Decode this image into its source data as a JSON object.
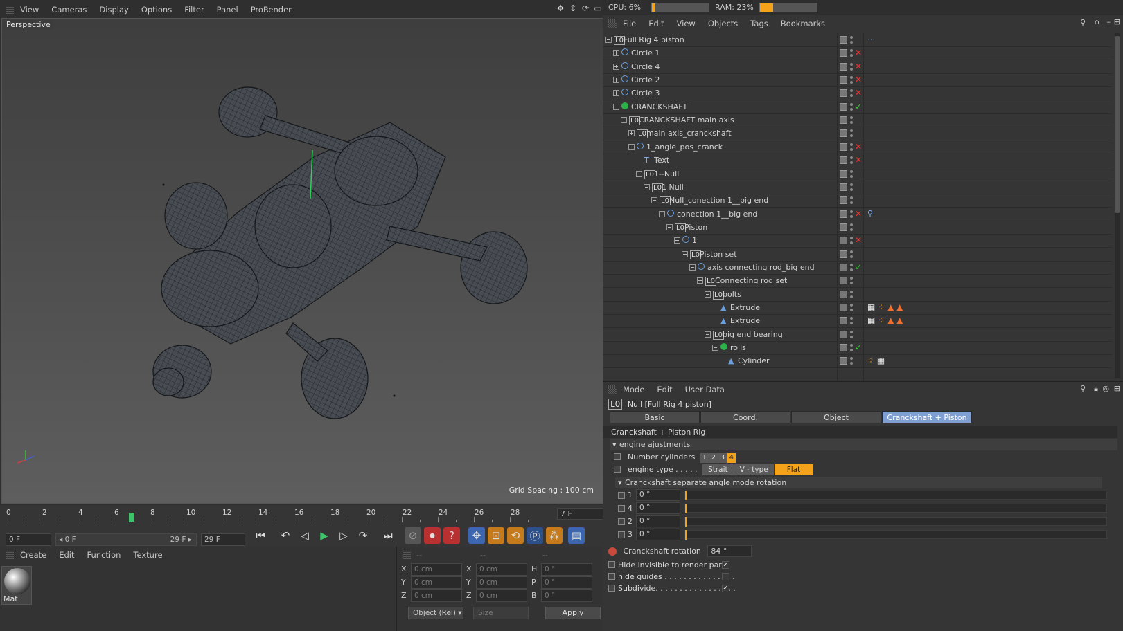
{
  "viewport": {
    "menu": [
      "View",
      "Cameras",
      "Display",
      "Options",
      "Filter",
      "Panel",
      "ProRender"
    ],
    "camera_label": "Perspective",
    "grid_spacing": "Grid Spacing : 100 cm"
  },
  "timeline": {
    "ticks": [
      "0",
      "2",
      "4",
      "6",
      "8",
      "10",
      "12",
      "14",
      "16",
      "18",
      "20",
      "22",
      "24",
      "26",
      "28"
    ],
    "current_frame": "7 F",
    "start_field": "0 F",
    "range_start": "◂ 0 F",
    "range_end": "29 F ▸",
    "end_field": "29 F"
  },
  "material_panel": {
    "menu": [
      "Create",
      "Edit",
      "Function",
      "Texture"
    ],
    "material_name": "Mat"
  },
  "coordinates": {
    "header": [
      "--",
      "--",
      "--"
    ],
    "rows": [
      {
        "a": "X",
        "av": "0 cm",
        "b": "X",
        "bv": "0 cm",
        "c": "H",
        "cv": "0 °"
      },
      {
        "a": "Y",
        "av": "0 cm",
        "b": "Y",
        "bv": "0 cm",
        "c": "P",
        "cv": "0 °"
      },
      {
        "a": "Z",
        "av": "0 cm",
        "b": "Z",
        "bv": "0 cm",
        "c": "B",
        "cv": "0 °"
      }
    ],
    "mode": "Object (Rel)",
    "size": "Size",
    "apply": "Apply"
  },
  "stats": {
    "cpu": "CPU: 6%",
    "cpu_pct": 6,
    "ram": "RAM: 23%",
    "ram_pct": 23
  },
  "object_manager": {
    "menu": [
      "File",
      "Edit",
      "View",
      "Objects",
      "Tags",
      "Bookmarks"
    ],
    "tree": [
      {
        "name": "Full Rig 4 piston",
        "depth": 0,
        "icon": "null",
        "flag": "",
        "exp": "minus"
      },
      {
        "name": "Circle 1",
        "depth": 1,
        "icon": "circle",
        "flag": "x",
        "exp": "plus"
      },
      {
        "name": "Circle 4",
        "depth": 1,
        "icon": "circle",
        "flag": "x",
        "exp": "plus"
      },
      {
        "name": "Circle 2",
        "depth": 1,
        "icon": "circle",
        "flag": "x",
        "exp": "plus"
      },
      {
        "name": "Circle 3",
        "depth": 1,
        "icon": "circle",
        "flag": "x",
        "exp": "plus"
      },
      {
        "name": "CRANCKSHAFT",
        "depth": 1,
        "icon": "gen",
        "flag": "check",
        "exp": "minus"
      },
      {
        "name": "CRANCKSHAFT main axis",
        "depth": 2,
        "icon": "null",
        "flag": "",
        "exp": "minus"
      },
      {
        "name": "main axis_cranckshaft",
        "depth": 3,
        "icon": "null",
        "flag": "",
        "exp": "plus"
      },
      {
        "name": "1_angle_pos_cranck",
        "depth": 3,
        "icon": "circle",
        "flag": "x",
        "exp": "minus"
      },
      {
        "name": "Text",
        "depth": 4,
        "icon": "text",
        "flag": "x",
        "exp": ""
      },
      {
        "name": "1--Null",
        "depth": 4,
        "icon": "null",
        "flag": "",
        "exp": "minus"
      },
      {
        "name": "1 Null",
        "depth": 5,
        "icon": "null",
        "flag": "",
        "exp": "minus"
      },
      {
        "name": "Null_conection 1__big end",
        "depth": 6,
        "icon": "null",
        "flag": "",
        "exp": "minus"
      },
      {
        "name": "conection 1__big end",
        "depth": 7,
        "icon": "circle",
        "flag": "x",
        "exp": "minus"
      },
      {
        "name": "Piston",
        "depth": 8,
        "icon": "null",
        "flag": "",
        "exp": "minus"
      },
      {
        "name": "1",
        "depth": 9,
        "icon": "circle",
        "flag": "x",
        "exp": "minus"
      },
      {
        "name": "Piston set",
        "depth": 10,
        "icon": "null",
        "flag": "",
        "exp": "minus"
      },
      {
        "name": "axis connecting rod_big end",
        "depth": 11,
        "icon": "circle",
        "flag": "check",
        "exp": "minus"
      },
      {
        "name": "Connecting rod set",
        "depth": 12,
        "icon": "null",
        "flag": "",
        "exp": "minus"
      },
      {
        "name": "bolts",
        "depth": 13,
        "icon": "null",
        "flag": "",
        "exp": "minus"
      },
      {
        "name": "Extrude",
        "depth": 14,
        "icon": "extrude",
        "flag": "",
        "exp": ""
      },
      {
        "name": "Extrude",
        "depth": 14,
        "icon": "extrude",
        "flag": "",
        "exp": ""
      },
      {
        "name": "big end bearing",
        "depth": 13,
        "icon": "null",
        "flag": "",
        "exp": "minus"
      },
      {
        "name": "rolls",
        "depth": 14,
        "icon": "gen",
        "flag": "check",
        "exp": "minus"
      },
      {
        "name": "Cylinder",
        "depth": 15,
        "icon": "extrude",
        "flag": "",
        "exp": ""
      }
    ]
  },
  "attributes": {
    "menu": [
      "Mode",
      "Edit",
      "User Data"
    ],
    "object_title": "Null [Full Rig 4 piston]",
    "tabs": [
      "Basic",
      "Coord.",
      "Object",
      "Cranckshaft + Piston Rig"
    ],
    "active_tab": 3,
    "group_title": "Cranckshaft + Piston Rig",
    "engine_section": "engine ajustments",
    "number_cylinders_label": "Number cylinders",
    "cylinder_options": [
      "1",
      "2",
      "3",
      "4"
    ],
    "cylinder_selected": 3,
    "engine_type_label": "engine type . . . . .",
    "engine_types": [
      "Strait",
      "V - type",
      "Flat"
    ],
    "engine_type_selected": 2,
    "rotation_section": "Cranckshaft separate angle mode rotation",
    "angles": [
      {
        "label": "1",
        "value": "0 °"
      },
      {
        "label": "4",
        "value": "0 °"
      },
      {
        "label": "2",
        "value": "0 °"
      },
      {
        "label": "3",
        "value": "0 °"
      }
    ],
    "crank_rotation_label": "Cranckshaft rotation",
    "crank_rotation_value": "84 °",
    "options": [
      {
        "label": "Hide invisible to render parts",
        "checked": true
      },
      {
        "label": "hide guides . . . . . . . . . . . . . . .",
        "checked": false
      },
      {
        "label": "Subdivide. . . . . . . . . . . . . . . . .",
        "checked": true
      }
    ]
  }
}
